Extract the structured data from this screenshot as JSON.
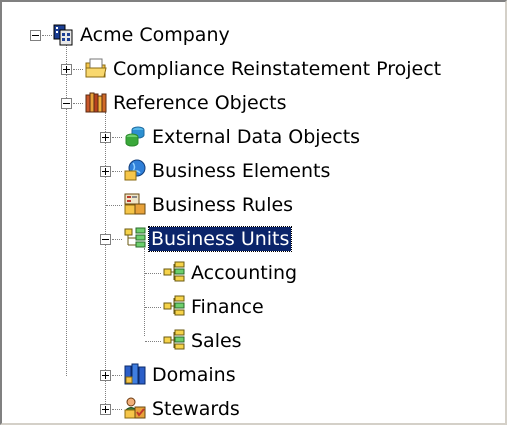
{
  "tree": {
    "root": {
      "label": "Acme Company",
      "icon": "organization-icon",
      "expanded": true
    },
    "compliance": {
      "label": "Compliance Reinstatement Project",
      "icon": "folder-project-icon",
      "expanded": false
    },
    "reference": {
      "label": "Reference Objects",
      "icon": "library-books-icon",
      "expanded": true
    },
    "external": {
      "label": "External Data Objects",
      "icon": "database-cylinders-icon",
      "expanded": false
    },
    "elements": {
      "label": "Business Elements",
      "icon": "globe-folder-icon",
      "expanded": false
    },
    "rules": {
      "label": "Business Rules",
      "icon": "rules-table-icon"
    },
    "units": {
      "label": "Business Units",
      "icon": "org-chart-icon",
      "expanded": true,
      "selected": true
    },
    "accounting": {
      "label": "Accounting",
      "icon": "org-chart-icon"
    },
    "finance": {
      "label": "Finance",
      "icon": "org-chart-icon"
    },
    "sales": {
      "label": "Sales",
      "icon": "org-chart-icon"
    },
    "domains": {
      "label": "Domains",
      "icon": "domains-books-icon",
      "expanded": false
    },
    "stewards": {
      "label": "Stewards",
      "icon": "stewards-people-icon",
      "expanded": false
    }
  },
  "colors": {
    "selection": "#0a246a",
    "tree_lines": "#808080"
  }
}
